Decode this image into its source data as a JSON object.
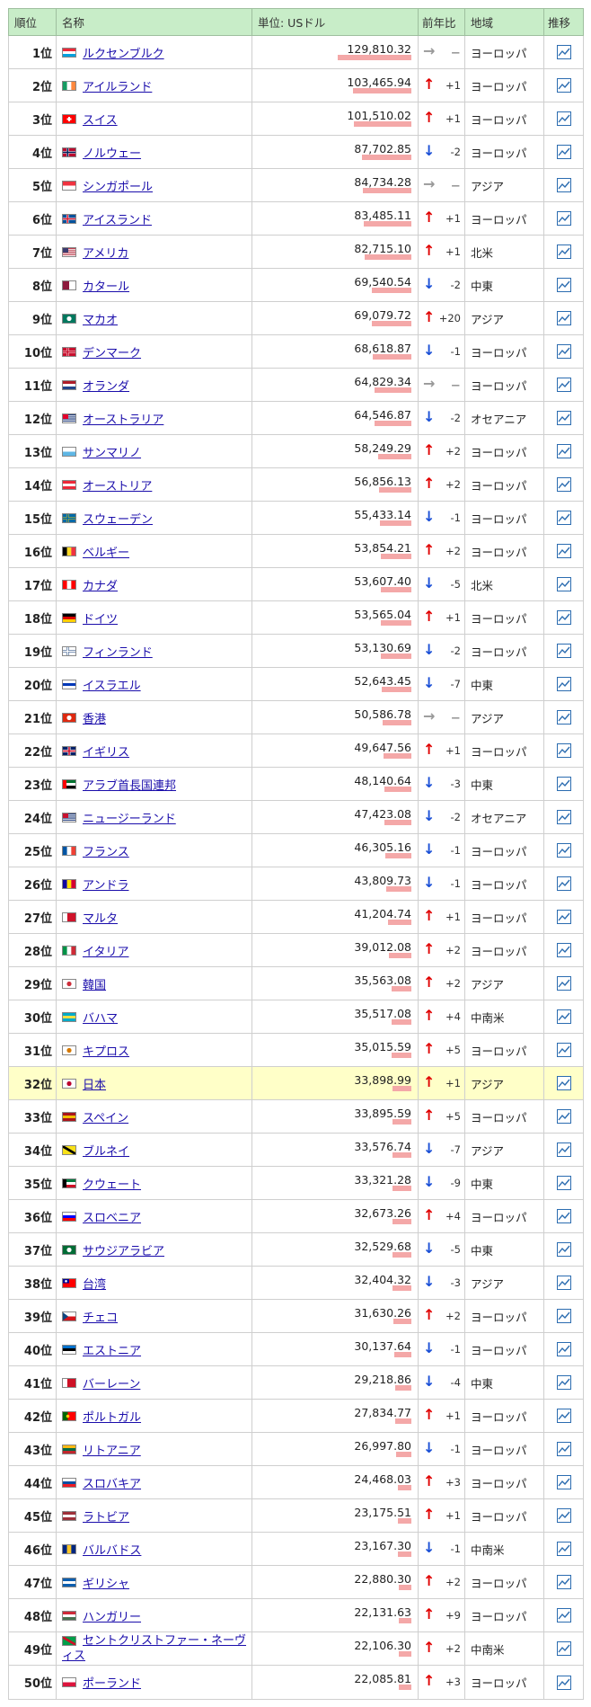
{
  "header": {
    "rank": "順位",
    "name": "名称",
    "unit": "単位: USドル",
    "change": "前年比",
    "region": "地域",
    "trend": "推移"
  },
  "rows": [
    {
      "rank": "1位",
      "name": "ルクセンブルク",
      "value": "129,810.32",
      "frac": 1.0,
      "dir": "eq",
      "delta": "－",
      "region": "ヨーロッパ",
      "flag": [
        "#ed2939",
        "#ffffff",
        "#00a1de"
      ],
      "fd": "h"
    },
    {
      "rank": "2位",
      "name": "アイルランド",
      "value": "103,465.94",
      "frac": 0.797,
      "dir": "up",
      "delta": "+1",
      "region": "ヨーロッパ",
      "flag": [
        "#169b62",
        "#ffffff",
        "#ff883e"
      ],
      "fd": "v"
    },
    {
      "rank": "3位",
      "name": "スイス",
      "value": "101,510.02",
      "frac": 0.782,
      "dir": "up",
      "delta": "+1",
      "region": "ヨーロッパ",
      "flag": [
        "#ff0000"
      ],
      "fd": "x"
    },
    {
      "rank": "4位",
      "name": "ノルウェー",
      "value": "87,702.85",
      "frac": 0.676,
      "dir": "dn",
      "delta": "-2",
      "region": "ヨーロッパ",
      "flag": [
        "#ba0c2f",
        "#ffffff",
        "#00205b"
      ],
      "fd": "n"
    },
    {
      "rank": "5位",
      "name": "シンガポール",
      "value": "84,734.28",
      "frac": 0.653,
      "dir": "eq",
      "delta": "－",
      "region": "アジア",
      "flag": [
        "#ef3340",
        "#ffffff"
      ],
      "fd": "h"
    },
    {
      "rank": "6位",
      "name": "アイスランド",
      "value": "83,485.11",
      "frac": 0.643,
      "dir": "up",
      "delta": "+1",
      "region": "ヨーロッパ",
      "flag": [
        "#02529c",
        "#ffffff",
        "#dc1e35"
      ],
      "fd": "n"
    },
    {
      "rank": "7位",
      "name": "アメリカ",
      "value": "82,715.10",
      "frac": 0.637,
      "dir": "up",
      "delta": "+1",
      "region": "北米",
      "flag": [
        "#b22234",
        "#ffffff",
        "#3c3b6e"
      ],
      "fd": "u"
    },
    {
      "rank": "8位",
      "name": "カタール",
      "value": "69,540.54",
      "frac": 0.536,
      "dir": "dn",
      "delta": "-2",
      "region": "中東",
      "flag": [
        "#8d1b3d",
        "#ffffff"
      ],
      "fd": "v"
    },
    {
      "rank": "9位",
      "name": "マカオ",
      "value": "69,079.72",
      "frac": 0.532,
      "dir": "up",
      "delta": "+20",
      "region": "アジア",
      "flag": [
        "#00785e",
        "#ffffff"
      ],
      "fd": "c"
    },
    {
      "rank": "10位",
      "name": "デンマーク",
      "value": "68,618.87",
      "frac": 0.529,
      "dir": "dn",
      "delta": "-1",
      "region": "ヨーロッパ",
      "flag": [
        "#c8102e",
        "#ffffff",
        "#c8102e"
      ],
      "fd": "n"
    },
    {
      "rank": "11位",
      "name": "オランダ",
      "value": "64,829.34",
      "frac": 0.499,
      "dir": "eq",
      "delta": "－",
      "region": "ヨーロッパ",
      "flag": [
        "#ae1c28",
        "#ffffff",
        "#21468b"
      ],
      "fd": "h"
    },
    {
      "rank": "12位",
      "name": "オーストラリア",
      "value": "64,546.87",
      "frac": 0.497,
      "dir": "dn",
      "delta": "-2",
      "region": "オセアニア",
      "flag": [
        "#012169",
        "#ffffff",
        "#e4002b"
      ],
      "fd": "u"
    },
    {
      "rank": "13位",
      "name": "サンマリノ",
      "value": "58,249.29",
      "frac": 0.449,
      "dir": "up",
      "delta": "+2",
      "region": "ヨーロッパ",
      "flag": [
        "#ffffff",
        "#5eb6e4"
      ],
      "fd": "h"
    },
    {
      "rank": "14位",
      "name": "オーストリア",
      "value": "56,856.13",
      "frac": 0.438,
      "dir": "up",
      "delta": "+2",
      "region": "ヨーロッパ",
      "flag": [
        "#ed2939",
        "#ffffff",
        "#ed2939"
      ],
      "fd": "h"
    },
    {
      "rank": "15位",
      "name": "スウェーデン",
      "value": "55,433.14",
      "frac": 0.427,
      "dir": "dn",
      "delta": "-1",
      "region": "ヨーロッパ",
      "flag": [
        "#006aa7",
        "#fecc00",
        "#006aa7"
      ],
      "fd": "n"
    },
    {
      "rank": "16位",
      "name": "ベルギー",
      "value": "53,854.21",
      "frac": 0.415,
      "dir": "up",
      "delta": "+2",
      "region": "ヨーロッパ",
      "flag": [
        "#000000",
        "#fdda24",
        "#ef3340"
      ],
      "fd": "v"
    },
    {
      "rank": "17位",
      "name": "カナダ",
      "value": "53,607.40",
      "frac": 0.413,
      "dir": "dn",
      "delta": "-5",
      "region": "北米",
      "flag": [
        "#ff0000",
        "#ffffff",
        "#ff0000"
      ],
      "fd": "v"
    },
    {
      "rank": "18位",
      "name": "ドイツ",
      "value": "53,565.04",
      "frac": 0.413,
      "dir": "up",
      "delta": "+1",
      "region": "ヨーロッパ",
      "flag": [
        "#000000",
        "#dd0000",
        "#ffce00"
      ],
      "fd": "h"
    },
    {
      "rank": "19位",
      "name": "フィンランド",
      "value": "53,130.69",
      "frac": 0.409,
      "dir": "dn",
      "delta": "-2",
      "region": "ヨーロッパ",
      "flag": [
        "#ffffff",
        "#002f6c",
        "#ffffff"
      ],
      "fd": "n"
    },
    {
      "rank": "20位",
      "name": "イスラエル",
      "value": "52,643.45",
      "frac": 0.406,
      "dir": "dn",
      "delta": "-7",
      "region": "中東",
      "flag": [
        "#ffffff",
        "#0038b8",
        "#ffffff"
      ],
      "fd": "h"
    },
    {
      "rank": "21位",
      "name": "香港",
      "value": "50,586.78",
      "frac": 0.39,
      "dir": "eq",
      "delta": "－",
      "region": "アジア",
      "flag": [
        "#de2910",
        "#ffffff"
      ],
      "fd": "c"
    },
    {
      "rank": "22位",
      "name": "イギリス",
      "value": "49,647.56",
      "frac": 0.382,
      "dir": "up",
      "delta": "+1",
      "region": "ヨーロッパ",
      "flag": [
        "#012169",
        "#ffffff",
        "#c8102e"
      ],
      "fd": "x2"
    },
    {
      "rank": "23位",
      "name": "アラブ首長国連邦",
      "value": "48,140.64",
      "frac": 0.371,
      "dir": "dn",
      "delta": "-3",
      "region": "中東",
      "flag": [
        "#00732f",
        "#ffffff",
        "#000000",
        "#ff0000"
      ],
      "fd": "ae"
    },
    {
      "rank": "24位",
      "name": "ニュージーランド",
      "value": "47,423.08",
      "frac": 0.365,
      "dir": "dn",
      "delta": "-2",
      "region": "オセアニア",
      "flag": [
        "#012169",
        "#ffffff",
        "#c8102e"
      ],
      "fd": "u"
    },
    {
      "rank": "25位",
      "name": "フランス",
      "value": "46,305.16",
      "frac": 0.357,
      "dir": "dn",
      "delta": "-1",
      "region": "ヨーロッパ",
      "flag": [
        "#0055a4",
        "#ffffff",
        "#ef4135"
      ],
      "fd": "v"
    },
    {
      "rank": "26位",
      "name": "アンドラ",
      "value": "43,809.73",
      "frac": 0.337,
      "dir": "dn",
      "delta": "-1",
      "region": "ヨーロッパ",
      "flag": [
        "#10069f",
        "#fedd00",
        "#d50032"
      ],
      "fd": "v"
    },
    {
      "rank": "27位",
      "name": "マルタ",
      "value": "41,204.74",
      "frac": 0.317,
      "dir": "up",
      "delta": "+1",
      "region": "ヨーロッパ",
      "flag": [
        "#ffffff",
        "#cf142b"
      ],
      "fd": "v2"
    },
    {
      "rank": "28位",
      "name": "イタリア",
      "value": "39,012.08",
      "frac": 0.301,
      "dir": "up",
      "delta": "+2",
      "region": "ヨーロッパ",
      "flag": [
        "#009246",
        "#ffffff",
        "#ce2b37"
      ],
      "fd": "v"
    },
    {
      "rank": "29位",
      "name": "韓国",
      "value": "35,563.08",
      "frac": 0.274,
      "dir": "up",
      "delta": "+2",
      "region": "アジア",
      "flag": [
        "#ffffff",
        "#cd2e3a"
      ],
      "fd": "c"
    },
    {
      "rank": "30位",
      "name": "バハマ",
      "value": "35,517.08",
      "frac": 0.274,
      "dir": "up",
      "delta": "+4",
      "region": "中南米",
      "flag": [
        "#00abc9",
        "#fae042",
        "#00abc9"
      ],
      "fd": "h"
    },
    {
      "rank": "31位",
      "name": "キプロス",
      "value": "35,015.59",
      "frac": 0.27,
      "dir": "up",
      "delta": "+5",
      "region": "ヨーロッパ",
      "flag": [
        "#ffffff",
        "#d57800"
      ],
      "fd": "c"
    },
    {
      "rank": "32位",
      "name": "日本",
      "value": "33,898.99",
      "frac": 0.261,
      "dir": "up",
      "delta": "+1",
      "region": "アジア",
      "flag": [
        "#ffffff",
        "#bc002d"
      ],
      "fd": "c",
      "highlight": true
    },
    {
      "rank": "33位",
      "name": "スペイン",
      "value": "33,895.59",
      "frac": 0.261,
      "dir": "up",
      "delta": "+5",
      "region": "ヨーロッパ",
      "flag": [
        "#aa151b",
        "#f1bf00",
        "#aa151b"
      ],
      "fd": "h"
    },
    {
      "rank": "34位",
      "name": "ブルネイ",
      "value": "33,576.74",
      "frac": 0.259,
      "dir": "dn",
      "delta": "-7",
      "region": "アジア",
      "flag": [
        "#f7e017",
        "#ffffff",
        "#000000"
      ],
      "fd": "d"
    },
    {
      "rank": "35位",
      "name": "クウェート",
      "value": "33,321.28",
      "frac": 0.257,
      "dir": "dn",
      "delta": "-9",
      "region": "中東",
      "flag": [
        "#007a3d",
        "#ffffff",
        "#ce1126",
        "#000000"
      ],
      "fd": "ae"
    },
    {
      "rank": "36位",
      "name": "スロベニア",
      "value": "32,673.26",
      "frac": 0.252,
      "dir": "up",
      "delta": "+4",
      "region": "ヨーロッパ",
      "flag": [
        "#ffffff",
        "#0000ff",
        "#ff0000"
      ],
      "fd": "h"
    },
    {
      "rank": "37位",
      "name": "サウジアラビア",
      "value": "32,529.68",
      "frac": 0.251,
      "dir": "dn",
      "delta": "-5",
      "region": "中東",
      "flag": [
        "#006c35",
        "#ffffff"
      ],
      "fd": "c"
    },
    {
      "rank": "38位",
      "name": "台湾",
      "value": "32,404.32",
      "frac": 0.25,
      "dir": "dn",
      "delta": "-3",
      "region": "アジア",
      "flag": [
        "#fe0000",
        "#000095"
      ],
      "fd": "tw"
    },
    {
      "rank": "39位",
      "name": "チェコ",
      "value": "31,630.26",
      "frac": 0.244,
      "dir": "up",
      "delta": "+2",
      "region": "ヨーロッパ",
      "flag": [
        "#ffffff",
        "#d7141a",
        "#11457e"
      ],
      "fd": "cz"
    },
    {
      "rank": "40位",
      "name": "エストニア",
      "value": "30,137.64",
      "frac": 0.232,
      "dir": "dn",
      "delta": "-1",
      "region": "ヨーロッパ",
      "flag": [
        "#0072ce",
        "#000000",
        "#ffffff"
      ],
      "fd": "h"
    },
    {
      "rank": "41位",
      "name": "バーレーン",
      "value": "29,218.86",
      "frac": 0.225,
      "dir": "dn",
      "delta": "-4",
      "region": "中東",
      "flag": [
        "#ffffff",
        "#ce1126"
      ],
      "fd": "v2"
    },
    {
      "rank": "42位",
      "name": "ポルトガル",
      "value": "27,834.77",
      "frac": 0.214,
      "dir": "up",
      "delta": "+1",
      "region": "ヨーロッパ",
      "flag": [
        "#006600",
        "#ff0000"
      ],
      "fd": "pt"
    },
    {
      "rank": "43位",
      "name": "リトアニア",
      "value": "26,997.80",
      "frac": 0.208,
      "dir": "dn",
      "delta": "-1",
      "region": "ヨーロッパ",
      "flag": [
        "#fdb913",
        "#006a44",
        "#c1272d"
      ],
      "fd": "h"
    },
    {
      "rank": "44位",
      "name": "スロバキア",
      "value": "24,468.03",
      "frac": 0.188,
      "dir": "up",
      "delta": "+3",
      "region": "ヨーロッパ",
      "flag": [
        "#ffffff",
        "#0b4ea2",
        "#ee1c25"
      ],
      "fd": "h"
    },
    {
      "rank": "45位",
      "name": "ラトビア",
      "value": "23,175.51",
      "frac": 0.179,
      "dir": "up",
      "delta": "+1",
      "region": "ヨーロッパ",
      "flag": [
        "#9e3039",
        "#ffffff",
        "#9e3039"
      ],
      "fd": "h"
    },
    {
      "rank": "46位",
      "name": "バルバドス",
      "value": "23,167.30",
      "frac": 0.178,
      "dir": "dn",
      "delta": "-1",
      "region": "中南米",
      "flag": [
        "#00267f",
        "#ffc726",
        "#00267f"
      ],
      "fd": "v"
    },
    {
      "rank": "47位",
      "name": "ギリシャ",
      "value": "22,880.30",
      "frac": 0.176,
      "dir": "up",
      "delta": "+2",
      "region": "ヨーロッパ",
      "flag": [
        "#0d5eaf",
        "#ffffff",
        "#0d5eaf"
      ],
      "fd": "h"
    },
    {
      "rank": "48位",
      "name": "ハンガリー",
      "value": "22,131.63",
      "frac": 0.17,
      "dir": "up",
      "delta": "+9",
      "region": "ヨーロッパ",
      "flag": [
        "#ce2939",
        "#ffffff",
        "#477050"
      ],
      "fd": "h"
    },
    {
      "rank": "49位",
      "name": "セントクリストファー・ネーヴィス",
      "value": "22,106.30",
      "frac": 0.17,
      "dir": "up",
      "delta": "+2",
      "region": "中南米",
      "flag": [
        "#009e49",
        "#000000",
        "#ce1126"
      ],
      "fd": "d",
      "wrap": true
    },
    {
      "rank": "50位",
      "name": "ポーランド",
      "value": "22,085.81",
      "frac": 0.17,
      "dir": "up",
      "delta": "+3",
      "region": "ヨーロッパ",
      "flag": [
        "#ffffff",
        "#dc143c"
      ],
      "fd": "h"
    }
  ],
  "icons": {
    "trend": "trend-chart-icon",
    "up": "arrow-up-icon",
    "down": "arrow-down-icon",
    "same": "arrow-right-icon"
  }
}
